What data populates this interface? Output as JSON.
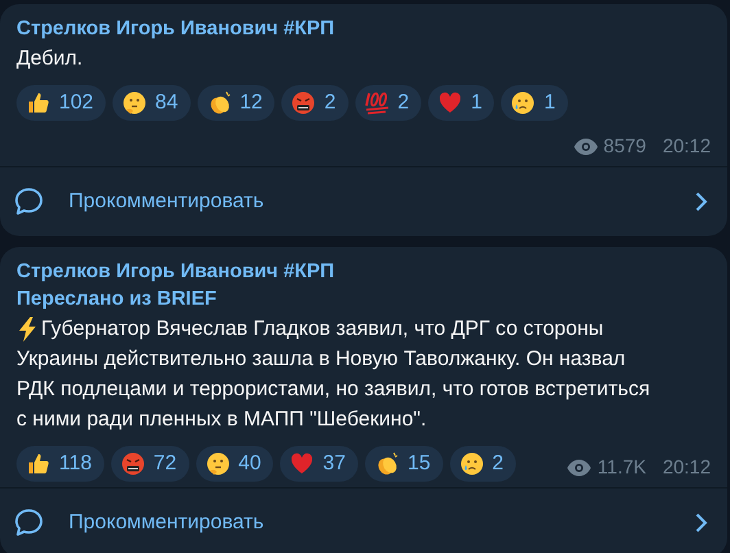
{
  "posts": [
    {
      "author": "Стрелков Игорь Иванович #КРП",
      "lightning": false,
      "text": "Дебил.",
      "reactions": [
        {
          "kind": "thumbs-up",
          "count": "102"
        },
        {
          "kind": "thinking",
          "count": "84"
        },
        {
          "kind": "clap",
          "count": "12"
        },
        {
          "kind": "angry",
          "count": "2"
        },
        {
          "kind": "hundred",
          "count": "2"
        },
        {
          "kind": "heart",
          "count": "1"
        },
        {
          "kind": "crying",
          "count": "1"
        }
      ],
      "views": "8579",
      "time": "20:12",
      "comment_label": "Прокомментировать"
    },
    {
      "author": "Стрелков Игорь Иванович #КРП",
      "forwarded_from": "Переслано из BRIEF",
      "lightning": true,
      "text": "Губернатор Вячеслав Гладков заявил, что ДРГ со стороны Украины действительно зашла в Новую Таволжанку. Он назвал РДК подлецами и террористами, но заявил, что готов встретиться с ними ради пленных в МАПП \"Шебекино\".",
      "reactions": [
        {
          "kind": "thumbs-up",
          "count": "118"
        },
        {
          "kind": "angry",
          "count": "72"
        },
        {
          "kind": "thinking",
          "count": "40"
        },
        {
          "kind": "heart",
          "count": "37"
        },
        {
          "kind": "clap",
          "count": "15"
        },
        {
          "kind": "crying",
          "count": "2"
        }
      ],
      "views": "11.7K",
      "time": "20:12",
      "comment_label": "Прокомментировать"
    }
  ]
}
